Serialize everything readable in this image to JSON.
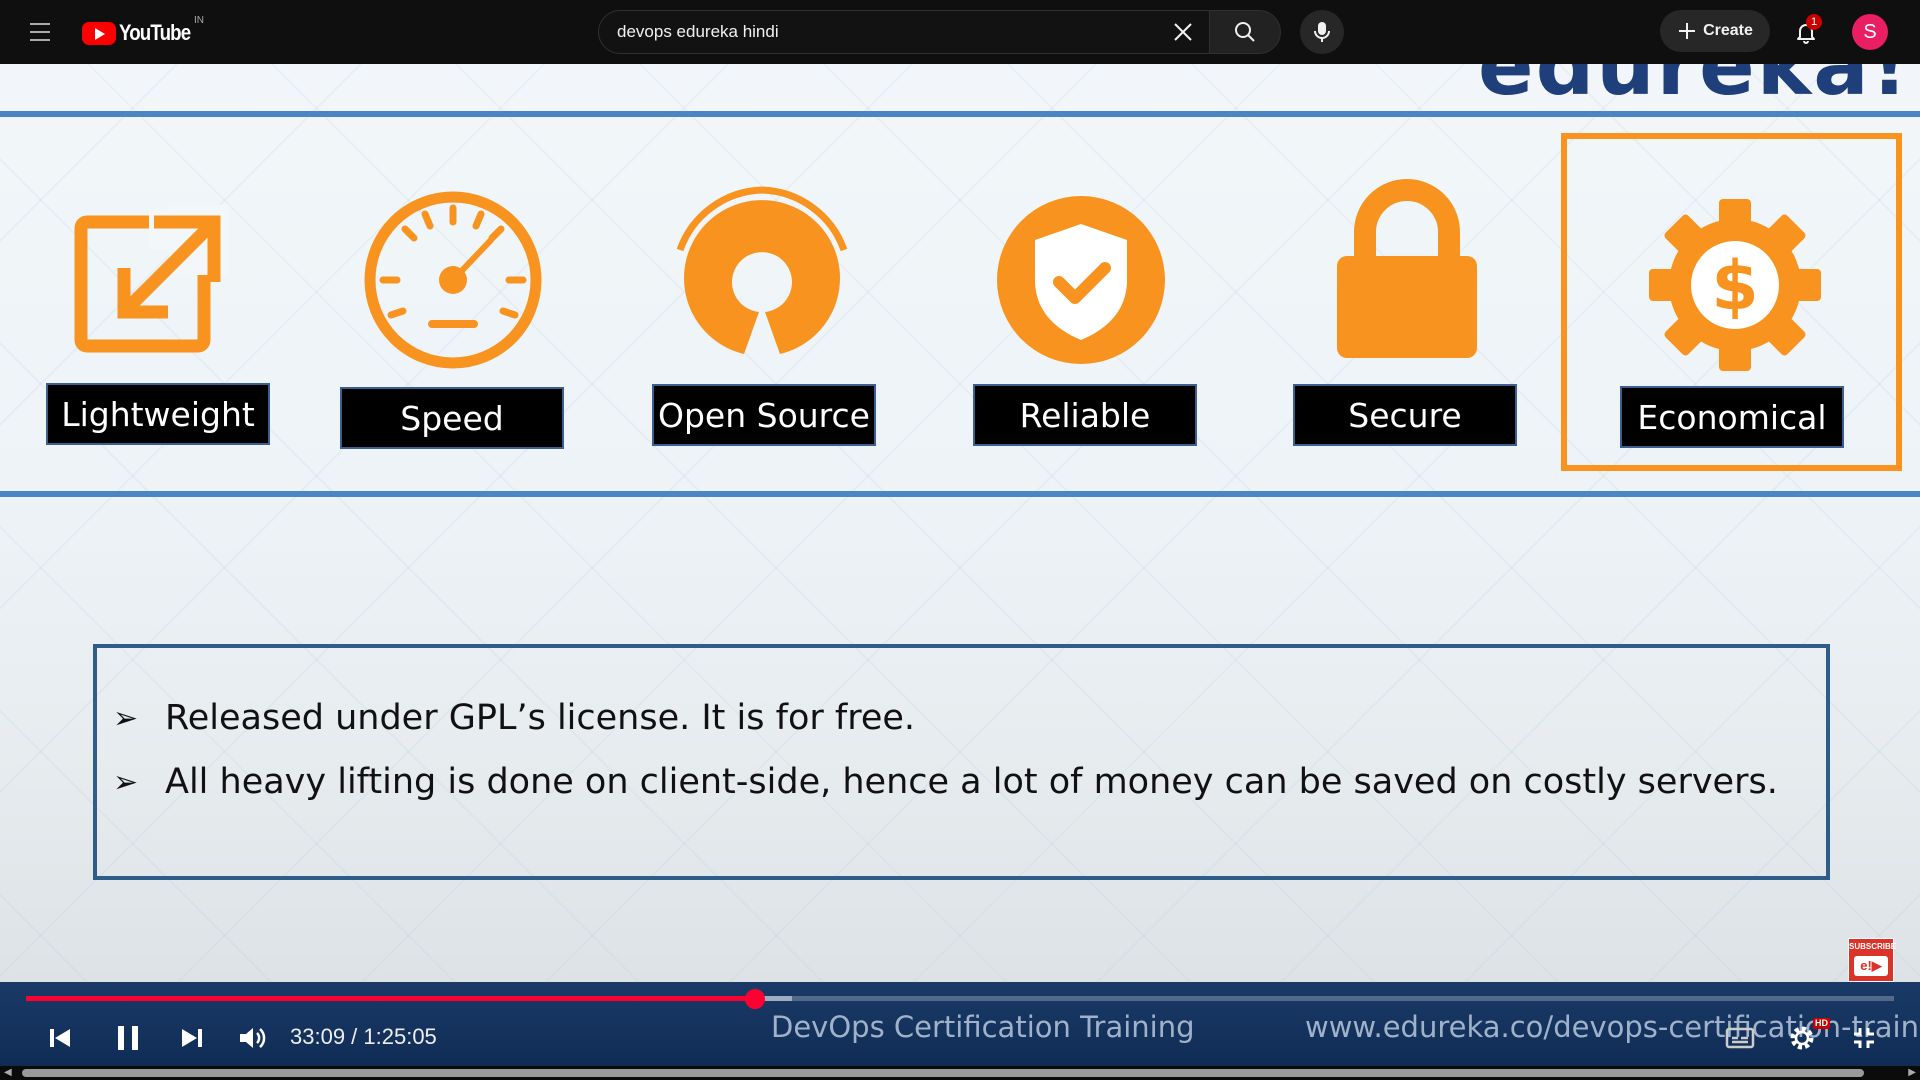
{
  "topbar": {
    "logo_text": "YouTube",
    "region": "IN",
    "search_value": "devops edureka hindi",
    "create_label": "Create",
    "notification_count": "1",
    "avatar_initial": "S"
  },
  "slide": {
    "features": [
      {
        "label": "Lightweight",
        "icon": "external-link-icon"
      },
      {
        "label": "Speed",
        "icon": "speedometer-icon"
      },
      {
        "label": "Open Source",
        "icon": "open-source-icon"
      },
      {
        "label": "Reliable",
        "icon": "shield-check-icon"
      },
      {
        "label": "Secure",
        "icon": "lock-icon"
      },
      {
        "label": "Economical",
        "icon": "dollar-gear-icon"
      }
    ],
    "highlighted_feature": "Economical",
    "bullets": [
      "Released under GPL’s license. It is for free.",
      "All heavy lifting is done on client-side, hence a lot of money can be saved on costly servers."
    ],
    "footer_title": "DevOps Certification Training",
    "footer_url": "www.edureka.co/devops-certification-training",
    "subscribe_text": "SUBSCRIBE",
    "accent_orange": "#f7931e",
    "accent_blue": "#4a86c5"
  },
  "player": {
    "current_time": "33:09",
    "duration": "1:25:05",
    "time_display": "33:09 / 1:25:05",
    "played_fraction": 0.39,
    "buffered_fraction": 0.41,
    "hd_badge": "HD"
  }
}
